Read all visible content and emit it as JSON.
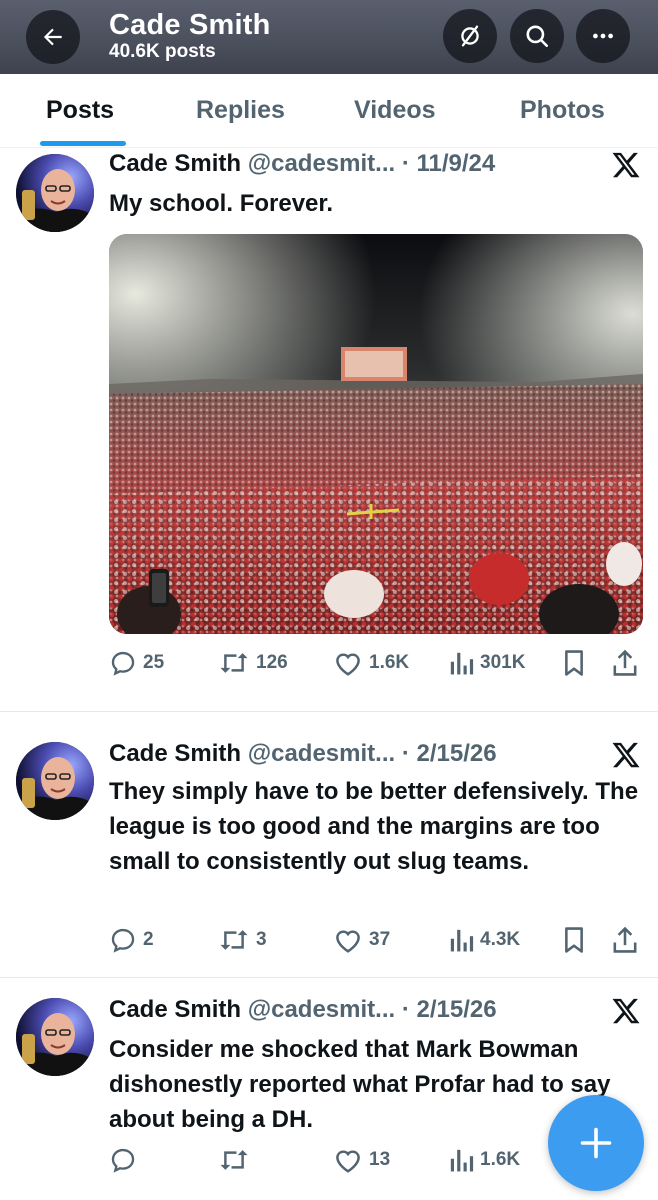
{
  "header": {
    "name": "Cade Smith",
    "posts_count": "40.6K posts",
    "back_icon": "arrow-left-icon",
    "actions": [
      "notifications-off-icon",
      "search-icon",
      "more-icon"
    ]
  },
  "tabs": [
    {
      "label": "Posts",
      "active": true
    },
    {
      "label": "Replies",
      "active": false
    },
    {
      "label": "Videos",
      "active": false
    },
    {
      "label": "Photos",
      "active": false
    }
  ],
  "posts": [
    {
      "name": "Cade Smith",
      "handle": "@cadesmit...",
      "date": "11/9/24",
      "text": "My school. Forever.",
      "has_photo": true,
      "replies": "25",
      "reposts": "126",
      "likes": "1.6K",
      "views": "301K"
    },
    {
      "name": "Cade Smith",
      "handle": "@cadesmit...",
      "date": "2/15/26",
      "text": "They simply have to be better defensively. The league is too good and the margins are too small to consistently out slug teams.",
      "has_photo": false,
      "replies": "2",
      "reposts": "3",
      "likes": "37",
      "views": "4.3K"
    },
    {
      "name": "Cade Smith",
      "handle": "@cadesmit...",
      "date": "2/15/26",
      "text": "Consider me shocked that Mark Bowman dishonestly reported what Profar had to say about being a DH.",
      "has_photo": false,
      "replies": "",
      "reposts": "",
      "likes": "13",
      "views": "1.6K"
    }
  ],
  "colors": {
    "accent": "#1d9bf0",
    "fab": "#3b9cf0",
    "secondary_text": "#536471"
  }
}
